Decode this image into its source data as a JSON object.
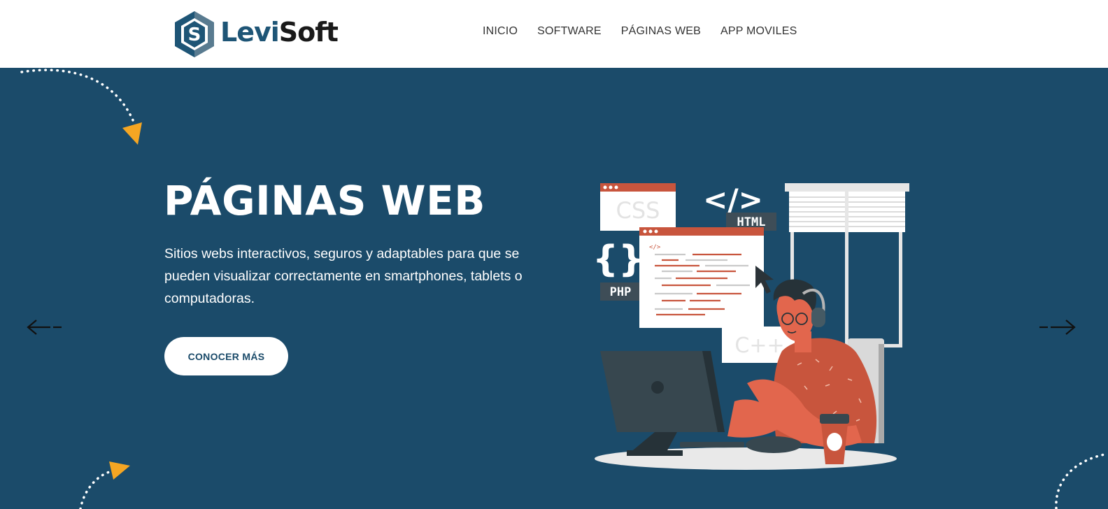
{
  "brand": {
    "name_part1": "Levi",
    "name_part2": "Soft",
    "logo_letter": "S"
  },
  "nav": {
    "items": [
      "INICIO",
      "SOFTWARE",
      "PÁGINAS WEB",
      "APP MOVILES"
    ]
  },
  "hero": {
    "title": "PÁGINAS WEB",
    "description": "Sitios webs interactivos, seguros y adaptables para que se pueden visualizar correctamente en smartphones, tablets o computadoras.",
    "cta_label": "CONOCER MÁS"
  },
  "illustration": {
    "labels": {
      "css": "CSS",
      "html_tag": "</>",
      "html": "HTML",
      "braces": "{}",
      "php": "PHP",
      "cpp": "C++",
      "code_icon": "</>"
    }
  },
  "colors": {
    "hero_bg": "#1b4b6a",
    "accent_orange": "#f5a623",
    "brand_blue": "#1e5576",
    "illustration_red": "#c8553d"
  },
  "icons": {
    "prev": "arrow-left-icon",
    "next": "arrow-right-icon"
  }
}
